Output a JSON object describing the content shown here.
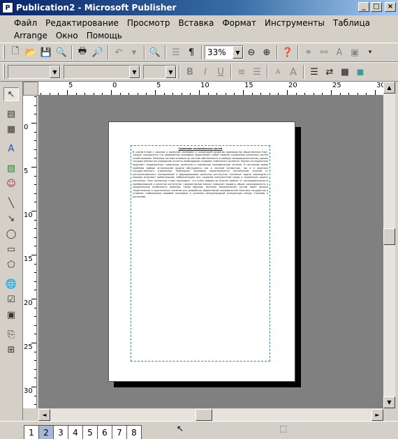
{
  "window": {
    "title": "Publication2 - Microsoft Publisher",
    "app_icon": "P",
    "minimize": "_",
    "maximize": "□",
    "close": "×"
  },
  "menu": [
    "Файл",
    "Редактирование",
    "Просмотр",
    "Вставка",
    "Формат",
    "Инструменты",
    "Таблица",
    "Arrange",
    "Окно",
    "Помощь"
  ],
  "toolbar1": {
    "zoom": "33%"
  },
  "document": {
    "heading": "Сравнение экономических систем",
    "body": "В соответствии с законом о рыночной экономике и концепцией развития производства общественных благ, следует подчеркнуть что современная экономика представляет собой сложное соединение различных систем хозяйствования. Рыночная система основана на частной собственности и свободе предпринимательства, однако государственное регулирование остаётся необходимым условием стабильного развития. Многие исследователи выделяют традиционную, командную, рыночную и смешанную экономические системы. В настоящее время проблема выбора оптимальной модели обсуждается как в научной литературе, так и в практике государственного управления. Переходная экономика характеризуется постепенным отказом от централизованного планирования и формированием рыночных институтов. Основные задачи переходного периода включают приватизацию, либерализацию цен, создание конкурентной среды и социальную защиту населения. Опыт различных стран показывает, что успех реформ во многом зависит от последовательности преобразований и качества институтов. Сравнительный анализ позволяет выявить общие закономерности и национальные особенности развития. Таким образом, изучение экономических систем имеет важное теоретическое и практическое значение для разработки эффективной экономической политики государства в условиях глобализации мировой экономики и усиления международной конкуренции между странами и регионами."
  },
  "ruler_h": [
    "5",
    "0",
    "5",
    "10",
    "15",
    "20",
    "25",
    "30"
  ],
  "ruler_v": [
    "5",
    "0",
    "5",
    "10",
    "15",
    "20",
    "25",
    "30"
  ],
  "pages": [
    "1",
    "2",
    "3",
    "4",
    "5",
    "6",
    "7",
    "8"
  ],
  "scroll": {
    "down": "▼",
    "up": "▲",
    "left": "◄",
    "right": "►"
  }
}
